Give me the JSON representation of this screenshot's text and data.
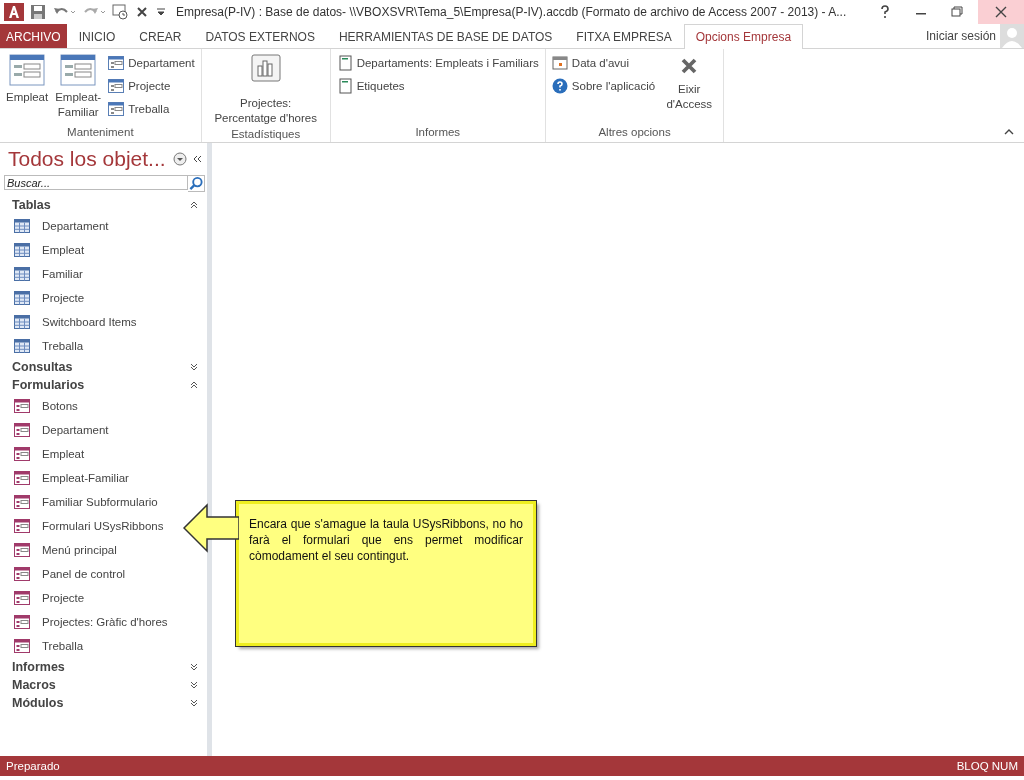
{
  "window": {
    "title": "Empresa(P-IV) : Base de datos- \\\\VBOXSVR\\Tema_5\\Empresa(P-IV).accdb (Formato de archivo de Access 2007 - 2013) - A..."
  },
  "tabs": [
    {
      "label": "ARCHIVO",
      "kind": "file",
      "selected": false
    },
    {
      "label": "INICIO",
      "kind": "tab",
      "selected": false
    },
    {
      "label": "CREAR",
      "kind": "tab",
      "selected": false
    },
    {
      "label": "DATOS EXTERNOS",
      "kind": "tab",
      "selected": false
    },
    {
      "label": "HERRAMIENTAS DE BASE DE DATOS",
      "kind": "tab",
      "selected": false
    },
    {
      "label": "FITXA EMPRESA",
      "kind": "tab",
      "selected": false
    },
    {
      "label": "Opcions Empresa",
      "kind": "tab",
      "selected": true
    }
  ],
  "sign_in": "Iniciar sesión",
  "ribbon": {
    "groups": [
      {
        "label": "Manteniment",
        "buttons": [
          {
            "label": "Empleat",
            "kind": "form"
          },
          {
            "label": "Empleat-Familiar",
            "kind": "form"
          }
        ],
        "small_buttons": [
          {
            "label": "Departament",
            "kind": "form"
          },
          {
            "label": "Projecte",
            "kind": "form"
          },
          {
            "label": "Treballa",
            "kind": "form"
          }
        ]
      },
      {
        "label": "Estadístiques",
        "buttons": [
          {
            "label": "Projectes: Percentatge d'hores",
            "kind": "chart"
          }
        ]
      },
      {
        "label": "Informes",
        "small_buttons": [
          {
            "label": "Departaments: Empleats i Familiars",
            "kind": "report"
          },
          {
            "label": "Etiquetes",
            "kind": "report"
          }
        ]
      },
      {
        "label": "Altres opcions",
        "small_buttons": [
          {
            "label": "Data d'avui",
            "kind": "calendar"
          },
          {
            "label": "Sobre l'aplicació",
            "kind": "help"
          }
        ],
        "buttons": [
          {
            "label": "Eixir d'Access",
            "kind": "exit"
          }
        ]
      }
    ]
  },
  "nav": {
    "title": "Todos los objet...",
    "search": {
      "placeholder": "Buscar..."
    },
    "groups": [
      {
        "label": "Tablas",
        "expanded": true,
        "items": [
          {
            "label": "Departament",
            "kind": "table"
          },
          {
            "label": "Empleat",
            "kind": "table"
          },
          {
            "label": "Familiar",
            "kind": "table"
          },
          {
            "label": "Projecte",
            "kind": "table"
          },
          {
            "label": "Switchboard Items",
            "kind": "table"
          },
          {
            "label": "Treballa",
            "kind": "table"
          }
        ]
      },
      {
        "label": "Consultas",
        "expanded": false
      },
      {
        "label": "Formularios",
        "expanded": true,
        "items": [
          {
            "label": "Botons",
            "kind": "form"
          },
          {
            "label": "Departament",
            "kind": "form"
          },
          {
            "label": "Empleat",
            "kind": "form"
          },
          {
            "label": "Empleat-Familiar",
            "kind": "form"
          },
          {
            "label": "Familiar Subformulario",
            "kind": "form"
          },
          {
            "label": "Formulari USysRibbons",
            "kind": "form"
          },
          {
            "label": "Menú principal",
            "kind": "form"
          },
          {
            "label": "Panel de control",
            "kind": "form"
          },
          {
            "label": "Projecte",
            "kind": "form"
          },
          {
            "label": "Projectes: Gràfic d'hores",
            "kind": "form"
          },
          {
            "label": "Treballa",
            "kind": "form"
          }
        ]
      },
      {
        "label": "Informes",
        "expanded": false
      },
      {
        "label": "Macros",
        "expanded": false
      },
      {
        "label": "Módulos",
        "expanded": false
      }
    ]
  },
  "callout": {
    "text": "Encara que s'amague la taula USysRibbons, no ho farà el formulari que ens permet modificar còmodament el seu contingut."
  },
  "status_bar": {
    "left": "Preparado",
    "right": "BLOQ NUM"
  }
}
